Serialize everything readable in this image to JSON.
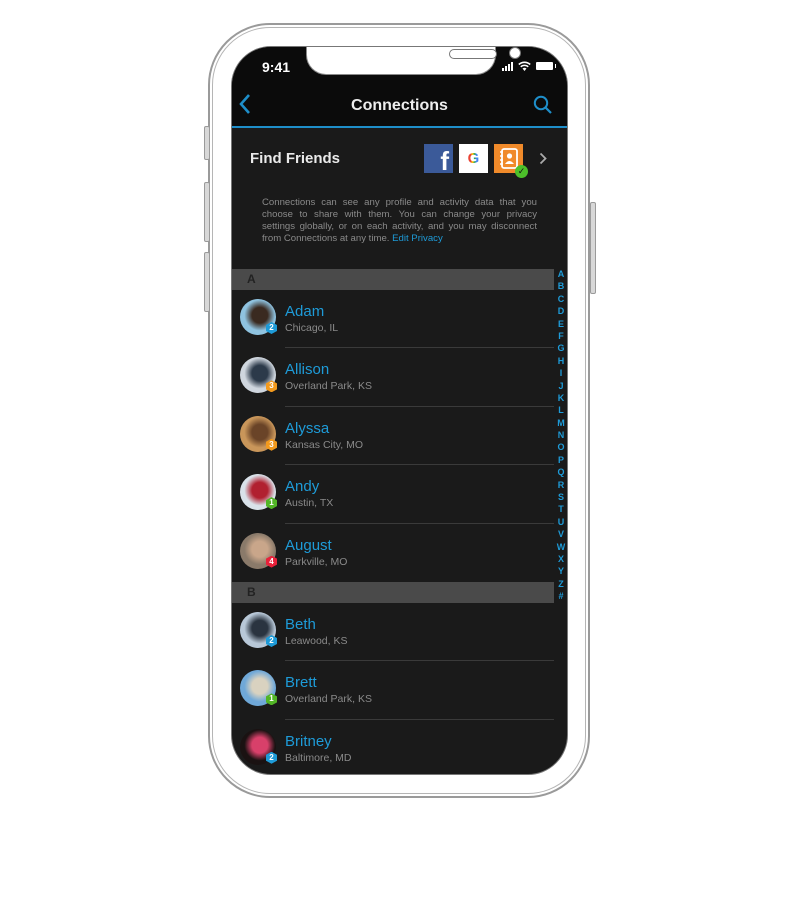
{
  "status_bar": {
    "time": "9:41"
  },
  "nav": {
    "back_icon": "chevron-left-icon",
    "title": "Connections",
    "search_icon": "search-icon"
  },
  "find_friends": {
    "label": "Find Friends",
    "sources": [
      {
        "name": "facebook",
        "glyph": "f"
      },
      {
        "name": "google",
        "glyph": "G"
      },
      {
        "name": "contacts",
        "connected": true
      }
    ]
  },
  "privacy": {
    "text": "Connections can see any profile and activity data that you choose to share with them. You can change your privacy settings globally, or on each activity, and you may disconnect from Connections at any time. ",
    "link": "Edit Privacy"
  },
  "sections": [
    {
      "letter": "A",
      "contacts": [
        {
          "name": "Adam",
          "location": "Chicago, IL",
          "badge": "2",
          "badge_color": "#1e9bd8",
          "avatar_colors": [
            "#8fc3e0",
            "#3a2a20"
          ]
        },
        {
          "name": "Allison",
          "location": "Overland Park, KS",
          "badge": "3",
          "badge_color": "#f39a1d",
          "avatar_colors": [
            "#cfd6de",
            "#2c3a4a"
          ]
        },
        {
          "name": "Alyssa",
          "location": "Kansas City, MO",
          "badge": "3",
          "badge_color": "#f39a1d",
          "avatar_colors": [
            "#c9965a",
            "#6a4428"
          ]
        },
        {
          "name": "Andy",
          "location": "Austin, TX",
          "badge": "1",
          "badge_color": "#52b526",
          "avatar_colors": [
            "#d9e2ea",
            "#b12030"
          ]
        },
        {
          "name": "August",
          "location": "Parkville, MO",
          "badge": "4",
          "badge_color": "#e8213a",
          "avatar_colors": [
            "#8a7a6a",
            "#c9a68a"
          ]
        }
      ]
    },
    {
      "letter": "B",
      "contacts": [
        {
          "name": "Beth",
          "location": "Leawood, KS",
          "badge": "2",
          "badge_color": "#1e9bd8",
          "avatar_colors": [
            "#b8c8d8",
            "#2a3440"
          ]
        },
        {
          "name": "Brett",
          "location": "Overland Park, KS",
          "badge": "1",
          "badge_color": "#52b526",
          "avatar_colors": [
            "#6fa8d8",
            "#d9d2c0"
          ]
        },
        {
          "name": "Britney",
          "location": "Baltimore, MD",
          "badge": "2",
          "badge_color": "#1e9bd8",
          "avatar_colors": [
            "#1a1212",
            "#d8406a"
          ]
        }
      ]
    }
  ],
  "alpha_index": [
    "A",
    "B",
    "C",
    "D",
    "E",
    "F",
    "G",
    "H",
    "I",
    "J",
    "K",
    "L",
    "M",
    "N",
    "O",
    "P",
    "Q",
    "R",
    "S",
    "T",
    "U",
    "V",
    "W",
    "X",
    "Y",
    "Z",
    "#"
  ]
}
